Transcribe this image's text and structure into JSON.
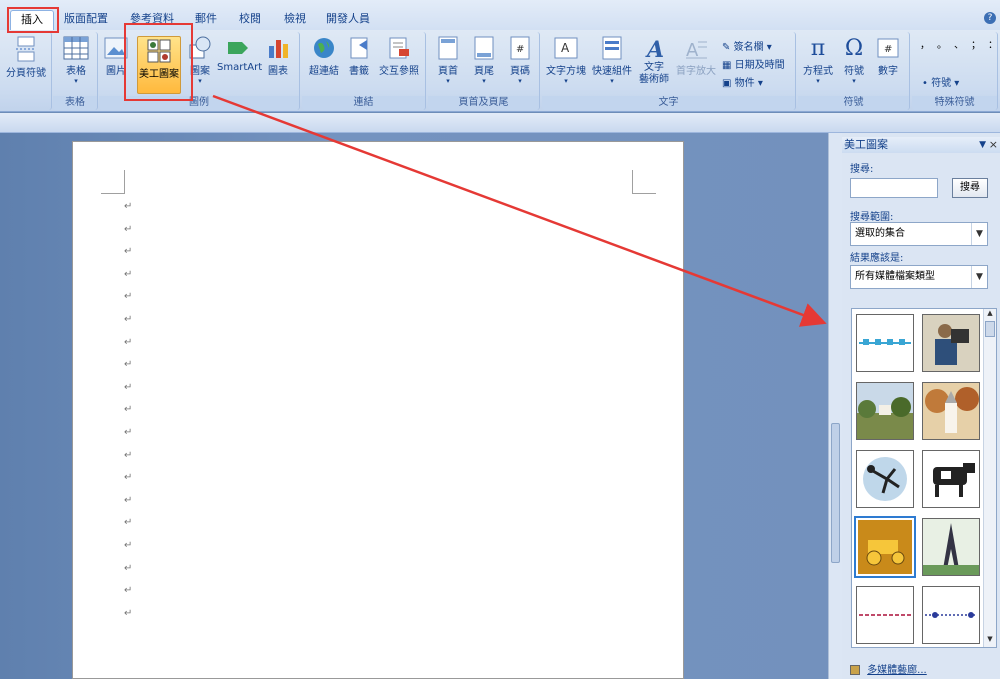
{
  "tabs": [
    {
      "label": "插入",
      "active": true
    },
    {
      "label": "版面配置"
    },
    {
      "label": "參考資料"
    },
    {
      "label": "郵件"
    },
    {
      "label": "校閱"
    },
    {
      "label": "檢視"
    },
    {
      "label": "開發人員"
    }
  ],
  "ribbon": {
    "pages": {
      "break_label": "分頁符號"
    },
    "table": {
      "label": "表格",
      "group": "表格"
    },
    "illus": {
      "picture": "圖片",
      "clipart": "美工圖案",
      "shapes": "圖案",
      "smartart": "SmartArt",
      "chart": "圖表",
      "group": "圖例"
    },
    "links": {
      "hyperlink": "超連結",
      "bookmark": "書籤",
      "crossref": "交互參照",
      "group": "連結"
    },
    "hf": {
      "header": "頁首",
      "footer": "頁尾",
      "pagenum": "頁碼",
      "group": "頁首及頁尾"
    },
    "text": {
      "textbox": "文字方塊",
      "quickparts": "快速組件",
      "wordart": "文字\n藝術師",
      "dropcap": "首字放大",
      "signature": "簽名欄",
      "datetime": "日期及時間",
      "object": "物件",
      "group": "文字"
    },
    "symbols": {
      "equation": "方程式",
      "symbol": "符號",
      "number": "數字",
      "group": "符號"
    },
    "special": {
      "symbol": "符號",
      "group": "特殊符號",
      "chars": "，。、；：？"
    }
  },
  "pane": {
    "title": "美工圖案",
    "search_label": "搜尋:",
    "search_value": "",
    "search_button": "搜尋",
    "scope_label": "搜尋範圍:",
    "scope_value": "選取的集合",
    "results_label": "結果應該是:",
    "results_value": "所有媒體檔案類型",
    "organize_link": "多媒體藝廊..."
  },
  "colors": {
    "highlight": "#e53935",
    "accent": "#15428b"
  },
  "paragraph_mark": "↵"
}
